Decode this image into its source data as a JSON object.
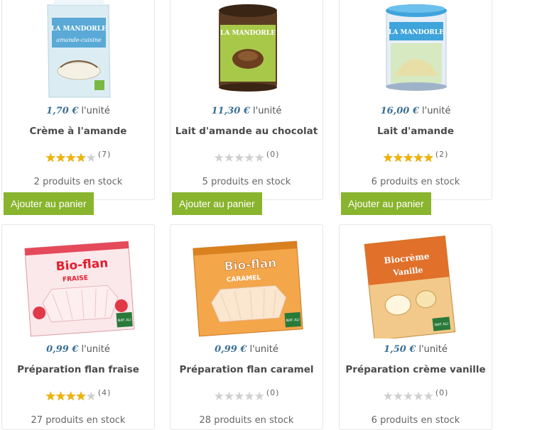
{
  "products": [
    {
      "price": "1,70 €",
      "unit": " l'unité",
      "name": "Crème à l'amande",
      "rating": 4,
      "count": "(7)",
      "stock": "2 produits en stock",
      "image": "amande-cuisine-carton"
    },
    {
      "price": "11,30 €",
      "unit": " l'unité",
      "name": "Lait d'amande au chocolat",
      "rating": 0,
      "count": "(0)",
      "stock": "5 produits en stock",
      "image": "chocolat-tin"
    },
    {
      "price": "16,00 €",
      "unit": " l'unité",
      "name": "Lait d'amande",
      "rating": 5,
      "count": "(2)",
      "stock": "6 produits en stock",
      "image": "lait-amande-tin"
    },
    {
      "price": "0,99 €",
      "unit": " l'unité",
      "name": "Préparation flan fraise",
      "rating": 4,
      "count": "(4)",
      "stock": "27 produits en stock",
      "image": "bio-flan-fraise"
    },
    {
      "price": "0,99 €",
      "unit": " l'unité",
      "name": "Préparation flan caramel",
      "rating": 0,
      "count": "(0)",
      "stock": "28 produits en stock",
      "image": "bio-flan-caramel"
    },
    {
      "price": "1,50 €",
      "unit": " l'unité",
      "name": "Préparation crème vanille",
      "rating": 0,
      "count": "(0)",
      "stock": "6 produits en stock",
      "image": "biocreme-vanille"
    }
  ],
  "add_to_cart_label": "Ajouter au panier",
  "packaging": {
    "p0": {
      "brand": "LA MANDORLE",
      "sub": "amande-cuisine"
    },
    "p1": {
      "brand": "LA MANDORLE"
    },
    "p2": {
      "brand": "LA MANDORLE"
    },
    "p3": {
      "brand": "Bio-flan",
      "flavor": "FRAISE",
      "logo": "NAT ALI"
    },
    "p4": {
      "brand": "Bio-flan",
      "flavor": "CARAMEL",
      "logo": "NAT ALI"
    },
    "p5": {
      "brand": "Biocrème",
      "flavor": "Vanille",
      "logo": "NAT ALI"
    }
  },
  "colors": {
    "accent": "#89b42d",
    "price": "#3a6f93",
    "star": "#f0b400"
  }
}
